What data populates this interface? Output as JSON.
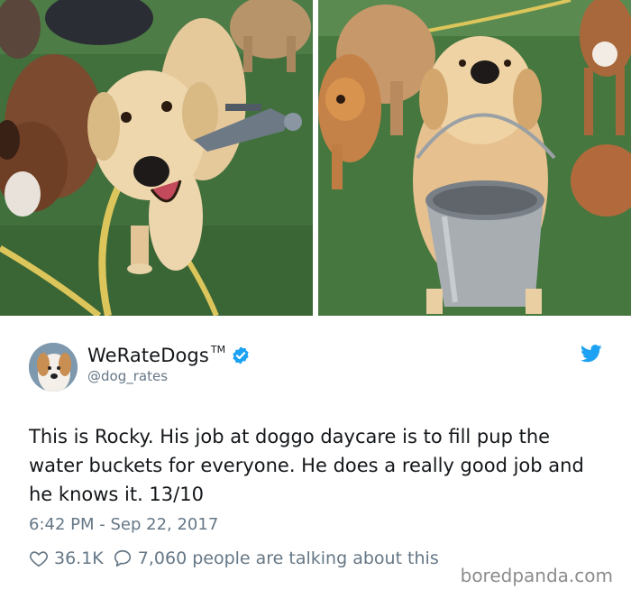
{
  "tweet": {
    "display_name": "WeRateDogs",
    "trademark": "TM",
    "handle": "@dog_rates",
    "text": "This is Rocky. His job at doggo daycare is to fill pup the water buckets for everyone. He does a really good job and he knows it. 13/10",
    "timestamp": "6:42 PM - Sep 22, 2017",
    "likes": "36.1K",
    "conversation": "7,060 people are talking about this"
  },
  "watermark": "boredpanda.com",
  "colors": {
    "twitter_blue": "#1DA1F2",
    "text": "#14171A",
    "muted": "#657786",
    "grass": "#3f6b3a"
  },
  "icons": [
    "verified-badge-icon",
    "twitter-bird-icon",
    "heart-icon",
    "speech-bubble-icon"
  ]
}
